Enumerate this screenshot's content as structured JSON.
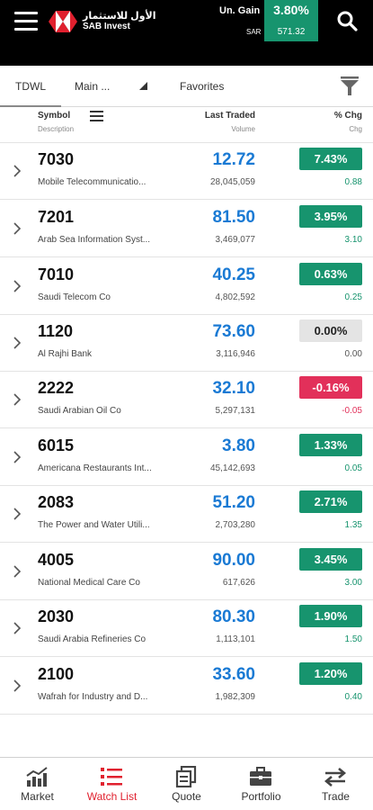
{
  "header": {
    "brand_ar": "الأول للاستثمار",
    "brand_en": "SAB Invest",
    "gain_label": "Un. Gain",
    "gain_pct": "3.80%",
    "currency_label": "SAR",
    "gain_value": "571.32"
  },
  "tabs": [
    {
      "label": "TDWL"
    },
    {
      "label": "Main ..."
    },
    {
      "label": "Favorites"
    }
  ],
  "columns": {
    "symbol": "Symbol",
    "description": "Description",
    "last_traded": "Last Traded",
    "volume": "Volume",
    "pct_chg": "% Chg",
    "chg": "Chg"
  },
  "rows": [
    {
      "symbol": "7030",
      "desc": "Mobile Telecommunicatio...",
      "price": "12.72",
      "volume": "28,045,059",
      "pct": "7.43%",
      "chg": "0.88",
      "status": "up"
    },
    {
      "symbol": "7201",
      "desc": "Arab Sea Information Syst...",
      "price": "81.50",
      "volume": "3,469,077",
      "pct": "3.95%",
      "chg": "3.10",
      "status": "up"
    },
    {
      "symbol": "7010",
      "desc": "Saudi Telecom Co",
      "price": "40.25",
      "volume": "4,802,592",
      "pct": "0.63%",
      "chg": "0.25",
      "status": "up"
    },
    {
      "symbol": "1120",
      "desc": "Al Rajhi Bank",
      "price": "73.60",
      "volume": "3,116,946",
      "pct": "0.00%",
      "chg": "0.00",
      "status": "flat"
    },
    {
      "symbol": "2222",
      "desc": "Saudi Arabian Oil Co",
      "price": "32.10",
      "volume": "5,297,131",
      "pct": "-0.16%",
      "chg": "-0.05",
      "status": "down"
    },
    {
      "symbol": "6015",
      "desc": "Americana Restaurants Int...",
      "price": "3.80",
      "volume": "45,142,693",
      "pct": "1.33%",
      "chg": "0.05",
      "status": "up"
    },
    {
      "symbol": "2083",
      "desc": "The Power and Water Utili...",
      "price": "51.20",
      "volume": "2,703,280",
      "pct": "2.71%",
      "chg": "1.35",
      "status": "up"
    },
    {
      "symbol": "4005",
      "desc": "National Medical Care Co",
      "price": "90.00",
      "volume": "617,626",
      "pct": "3.45%",
      "chg": "3.00",
      "status": "up"
    },
    {
      "symbol": "2030",
      "desc": "Saudi Arabia Refineries Co",
      "price": "80.30",
      "volume": "1,113,101",
      "pct": "1.90%",
      "chg": "1.50",
      "status": "up"
    },
    {
      "symbol": "2100",
      "desc": "Wafrah for Industry and D...",
      "price": "33.60",
      "volume": "1,982,309",
      "pct": "1.20%",
      "chg": "0.40",
      "status": "up"
    }
  ],
  "nav": [
    {
      "label": "Market",
      "icon": "bar-chart-icon"
    },
    {
      "label": "Watch List",
      "icon": "list-icon",
      "active": true
    },
    {
      "label": "Quote",
      "icon": "quote-icon"
    },
    {
      "label": "Portfolio",
      "icon": "briefcase-icon"
    },
    {
      "label": "Trade",
      "icon": "trade-arrows-icon"
    }
  ],
  "colors": {
    "up_bg": "#17946e",
    "up_text": "#17946e",
    "down_bg": "#e2305a",
    "down_text": "#e2305a",
    "flat_bg": "#e4e4e4",
    "flat_text": "#555555",
    "price": "#1a7ad4",
    "brand_red": "#e0202e",
    "gain_bg": "#17946e"
  }
}
